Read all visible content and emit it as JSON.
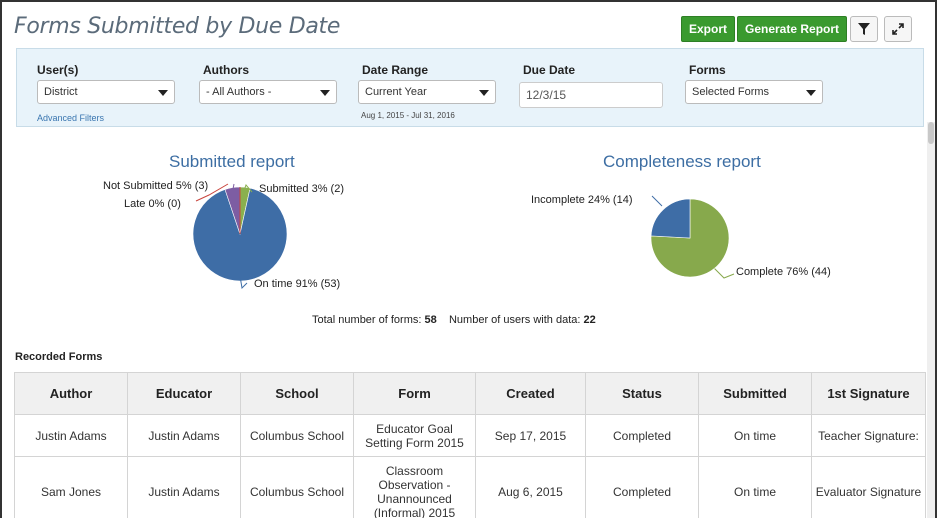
{
  "page": {
    "title": "Forms Submitted by Due Date",
    "export_label": "Export",
    "generate_label": "Generate Report",
    "filter_icon": "filter-icon",
    "expand_icon": "expand-icon"
  },
  "filters": {
    "users": {
      "label": "User(s)",
      "value": "District"
    },
    "authors": {
      "label": "Authors",
      "value": "- All Authors -"
    },
    "date_range": {
      "label": "Date Range",
      "value": "Current Year",
      "sub": "Aug 1, 2015 - Jul 31, 2016"
    },
    "due_date": {
      "label": "Due Date",
      "value": "12/3/15"
    },
    "forms": {
      "label": "Forms",
      "value": "Selected Forms"
    },
    "advanced_link": "Advanced Filters"
  },
  "submitted_report": {
    "title": "Submitted report",
    "labels": {
      "not_submitted": "Not Submitted 5% (3)",
      "late": "Late 0% (0)",
      "submitted": "Submitted 3% (2)",
      "on_time": "On time 91% (53)"
    }
  },
  "completeness_report": {
    "title": "Completeness report",
    "labels": {
      "incomplete": "Incomplete 24% (14)",
      "complete": "Complete 76% (44)"
    }
  },
  "chart_data": [
    {
      "type": "pie",
      "title": "Submitted report",
      "categories": [
        "On time",
        "Submitted",
        "Late",
        "Not Submitted"
      ],
      "values": [
        53,
        2,
        0,
        3
      ],
      "percents": [
        91,
        3,
        0,
        5
      ],
      "colors": [
        "#3e6da6",
        "#8ab04e",
        "#c9453e",
        "#7d5da3"
      ]
    },
    {
      "type": "pie",
      "title": "Completeness report",
      "categories": [
        "Complete",
        "Incomplete"
      ],
      "values": [
        44,
        14
      ],
      "percents": [
        76,
        24
      ],
      "colors": [
        "#87a94c",
        "#3e6da6"
      ]
    }
  ],
  "totals": {
    "forms_label": "Total number of forms:",
    "forms_value": "58",
    "users_label": "Number of users with data:",
    "users_value": "22"
  },
  "recorded_forms": {
    "title": "Recorded Forms",
    "columns": [
      "Author",
      "Educator",
      "School",
      "Form",
      "Created",
      "Status",
      "Submitted",
      "1st Signature"
    ],
    "rows": [
      [
        "Justin Adams",
        "Justin Adams",
        "Columbus School",
        "Educator Goal Setting Form 2015",
        "Sep 17, 2015",
        "Completed",
        "On time",
        "Teacher Signature:"
      ],
      [
        "Sam Jones",
        "Justin Adams",
        "Columbus School",
        "Classroom Observation - Unannounced (Informal) 2015",
        "Aug 6, 2015",
        "Completed",
        "On time",
        "Evaluator Signature"
      ]
    ]
  }
}
